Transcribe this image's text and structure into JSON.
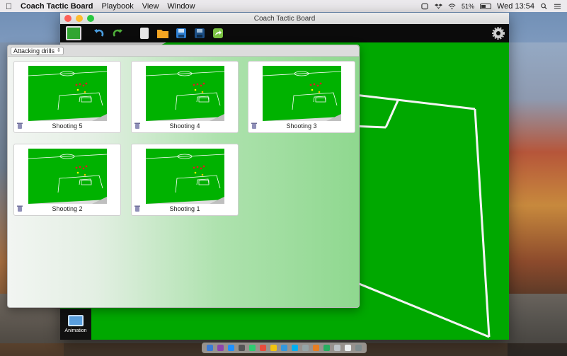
{
  "menubar": {
    "apple_icon": "apple-logo-icon",
    "app_name": "Coach Tactic Board",
    "menus": [
      "Playbook",
      "View",
      "Window"
    ],
    "battery_percent": "51%",
    "clock": "Wed 13:54",
    "status_icons": [
      "icloud-icon",
      "dropbox-icon",
      "wifi-icon",
      "battery-icon",
      "search-icon",
      "menu-list-icon"
    ]
  },
  "window": {
    "title": "Coach Tactic Board",
    "toolbar_icons": [
      "field-icon",
      "undo-icon",
      "redo-icon",
      "new-document-icon",
      "open-folder-icon",
      "save-icon",
      "save-as-icon",
      "share-icon",
      "settings-gear-icon"
    ],
    "animation_label": "Animation"
  },
  "drills_panel": {
    "category": "Attacking drills",
    "items": [
      {
        "label": "Shooting 5"
      },
      {
        "label": "Shooting 4"
      },
      {
        "label": "Shooting 3"
      },
      {
        "label": "Shooting 2"
      },
      {
        "label": "Shooting 1"
      }
    ]
  },
  "colors": {
    "pitch_green": "#00a800",
    "toolbar_bg": "#0b0b0b",
    "menubar_bg": "#eceaed"
  }
}
